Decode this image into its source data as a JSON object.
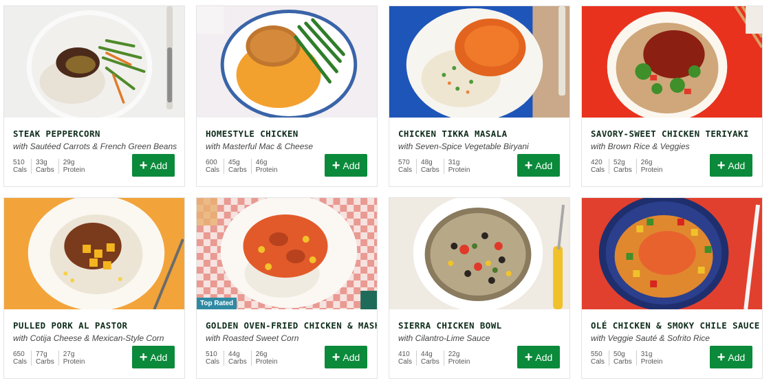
{
  "meals": [
    {
      "title": "STEAK PEPPERCORN",
      "subtitle": "with Sautéed Carrots & French Green Beans",
      "cals": "510",
      "carbs": "33g",
      "protein": "29g",
      "badge": ""
    },
    {
      "title": "HOMESTYLE CHICKEN",
      "subtitle": "with Masterful Mac & Cheese",
      "cals": "600",
      "carbs": "45g",
      "protein": "46g",
      "badge": ""
    },
    {
      "title": "CHICKEN TIKKA MASALA",
      "subtitle": "with Seven-Spice Vegetable Biryani",
      "cals": "570",
      "carbs": "48g",
      "protein": "31g",
      "badge": ""
    },
    {
      "title": "SAVORY-SWEET CHICKEN TERIYAKI",
      "subtitle": "with Brown Rice & Veggies",
      "cals": "420",
      "carbs": "52g",
      "protein": "26g",
      "badge": ""
    },
    {
      "title": "PULLED PORK AL PASTOR",
      "subtitle": "with Cotija Cheese & Mexican-Style Corn",
      "cals": "650",
      "carbs": "77g",
      "protein": "27g",
      "badge": ""
    },
    {
      "title": "GOLDEN OVEN-FRIED CHICKEN & MASH",
      "subtitle": "with Roasted Sweet Corn",
      "cals": "510",
      "carbs": "44g",
      "protein": "26g",
      "badge": "Top Rated"
    },
    {
      "title": "SIERRA CHICKEN BOWL",
      "subtitle": "with Cilantro-Lime Sauce",
      "cals": "410",
      "carbs": "44g",
      "protein": "22g",
      "badge": ""
    },
    {
      "title": "OLÉ CHICKEN & SMOKY CHILE SAUCE",
      "subtitle": "with Veggie Sauté & Sofrito Rice",
      "cals": "550",
      "carbs": "50g",
      "protein": "31g",
      "badge": ""
    }
  ],
  "labels": {
    "cals": "Cals",
    "carbs": "Carbs",
    "protein": "Protein",
    "add": "Add"
  },
  "colors": {
    "add_button": "#0a8a3a",
    "badge": "#2f8aa3",
    "title": "#0f2d1c"
  }
}
